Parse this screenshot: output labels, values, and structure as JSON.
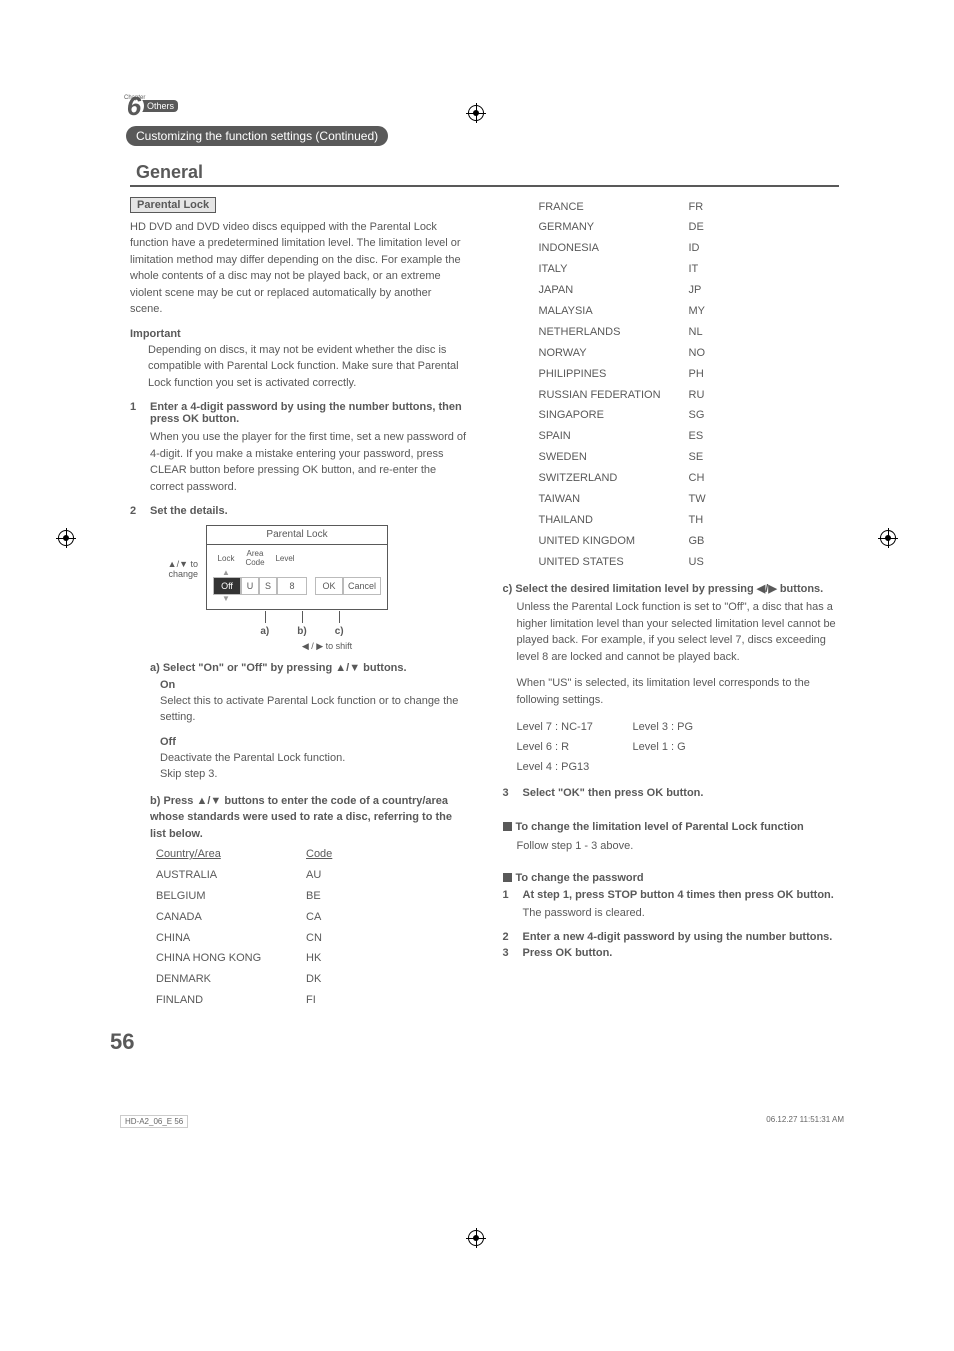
{
  "chapter": {
    "number": "6",
    "prefix": "Chapter",
    "name": "Others"
  },
  "continued": "Customizing the function settings (Continued)",
  "section": "General",
  "parentalLock": {
    "label": "Parental Lock",
    "intro": "HD DVD and DVD video discs equipped with the Parental Lock function have a predetermined limitation level. The limitation level or limitation method may differ depending on the disc. For example the whole contents of a disc may not be played back, or an extreme violent scene may be cut or replaced automatically by another scene.",
    "importantHead": "Important",
    "importantText": "Depending on discs, it may not be evident whether the disc is compatible with Parental Lock function. Make sure that Parental Lock function you set is activated correctly.",
    "step1": "Enter a 4-digit password by using the number buttons, then press OK button.",
    "step1Body": "When you use the player for the first time, set a new password of 4-digit. If you make a mistake entering your password, press CLEAR button before pressing OK button, and re-enter the correct password.",
    "step2": "Set the details.",
    "diagram": {
      "title": "Parental Lock",
      "leftNote": "▲/▼ to change",
      "hLock": "Lock",
      "hArea": "Area Code",
      "hLevel": "Level",
      "vOff": "Off",
      "vU": "U",
      "vS": "S",
      "vLevel": "8",
      "vOK": "OK",
      "vCancel": "Cancel",
      "a": "a)",
      "b": "b)",
      "c": "c)",
      "shift": "◀ / ▶ to shift"
    },
    "aHead": "a) Select \"On\" or \"Off\" by pressing ▲/▼ buttons.",
    "onHead": "On",
    "onText": "Select this to activate Parental Lock function or to change the setting.",
    "offHead": "Off",
    "offText1": "Deactivate the Parental Lock function.",
    "offText2": "Skip step 3.",
    "bHead": "b) Press ▲/▼ buttons to enter the code of a country/area whose standards were used to rate a disc, referring to the list below.",
    "tableHead1": "Country/Area",
    "tableHead2": "Code",
    "countriesLeft": [
      [
        "AUSTRALIA",
        "AU"
      ],
      [
        "BELGIUM",
        "BE"
      ],
      [
        "CANADA",
        "CA"
      ],
      [
        "CHINA",
        "CN"
      ],
      [
        "CHINA HONG KONG",
        "HK"
      ],
      [
        "DENMARK",
        "DK"
      ],
      [
        "FINLAND",
        "FI"
      ]
    ],
    "countriesRight": [
      [
        "FRANCE",
        "FR"
      ],
      [
        "GERMANY",
        "DE"
      ],
      [
        "INDONESIA",
        "ID"
      ],
      [
        "ITALY",
        "IT"
      ],
      [
        "JAPAN",
        "JP"
      ],
      [
        "MALAYSIA",
        "MY"
      ],
      [
        "NETHERLANDS",
        "NL"
      ],
      [
        "NORWAY",
        "NO"
      ],
      [
        "PHILIPPINES",
        "PH"
      ],
      [
        "RUSSIAN FEDERATION",
        "RU"
      ],
      [
        "SINGAPORE",
        "SG"
      ],
      [
        "SPAIN",
        "ES"
      ],
      [
        "SWEDEN",
        "SE"
      ],
      [
        "SWITZERLAND",
        "CH"
      ],
      [
        "TAIWAN",
        "TW"
      ],
      [
        "THAILAND",
        "TH"
      ],
      [
        "UNITED KINGDOM",
        "GB"
      ],
      [
        "UNITED STATES",
        "US"
      ]
    ],
    "cHead": "c) Select the desired limitation level by pressing ◀/▶ buttons.",
    "cBody1": "Unless the Parental Lock function is set to \"Off\", a disc that has a higher limitation level than your selected limitation level cannot be played back. For example, if you select level 7, discs exceeding level 8 are locked and cannot be played back.",
    "cBody2": "When \"US\" is selected, its limitation level corresponds to the following settings.",
    "levelsL1a": "Level 7 : NC-17",
    "levelsL1b": "Level 3 : PG",
    "levelsL2a": "Level 6 : R",
    "levelsL2b": "Level 1 : G",
    "levelsL3a": "Level 4 : PG13",
    "step3": "Select \"OK\" then press OK button.",
    "changeLevelHead": "To change the limitation level of Parental Lock function",
    "changeLevelBody": "Follow step 1 - 3 above.",
    "changePwHead": "To change the password",
    "pwStep1": "At step 1, press STOP button 4 times then press OK button.",
    "pwStep1Body": "The password is cleared.",
    "pwStep2": "Enter a new 4-digit password by using the number buttons.",
    "pwStep3": "Press OK button."
  },
  "pageNumber": "56",
  "footer": {
    "left": "HD-A2_06_E   56",
    "right": "06.12.27   11:51:31 AM"
  }
}
